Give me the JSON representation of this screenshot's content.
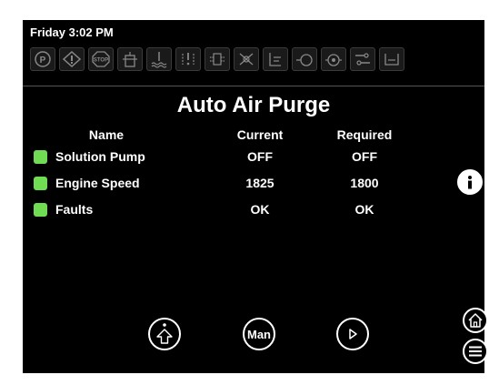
{
  "status": {
    "clock": "Friday 3:02 PM"
  },
  "indicators": [
    {
      "icon": "parking-brake-icon",
      "label": "(P)"
    },
    {
      "icon": "warning-icon",
      "label": "!"
    },
    {
      "icon": "stop-icon",
      "label": "STOP"
    },
    {
      "icon": "fluid-level-icon",
      "label": ""
    },
    {
      "icon": "coolant-temp-icon",
      "label": ""
    },
    {
      "icon": "air-filter-icon",
      "label": ""
    },
    {
      "icon": "fuel-filter-icon",
      "label": ""
    },
    {
      "icon": "heater-icon",
      "label": ""
    },
    {
      "icon": "oil-level-icon",
      "label": ""
    },
    {
      "icon": "pump-icon",
      "label": ""
    },
    {
      "icon": "engine-icon",
      "label": ""
    },
    {
      "icon": "hose-icon",
      "label": ""
    },
    {
      "icon": "tank-icon",
      "label": ""
    }
  ],
  "page": {
    "title": "Auto Air Purge"
  },
  "table": {
    "headers": {
      "name": "Name",
      "current": "Current",
      "required": "Required"
    },
    "rows": [
      {
        "name": "Solution Pump",
        "current": "OFF",
        "required": "OFF",
        "status_color": "#6fdc53"
      },
      {
        "name": "Engine Speed",
        "current": "1825",
        "required": "1800",
        "status_color": "#6fdc53"
      },
      {
        "name": "Faults",
        "current": "OK",
        "required": "OK",
        "status_color": "#6fdc53"
      }
    ]
  },
  "buttons": {
    "info": "info-icon",
    "man_label": "Man",
    "home": "home-icon",
    "menu": "menu-icon",
    "step_up": "up-arrow-icon",
    "play": "play-icon"
  },
  "colors": {
    "ok_led": "#6fdc53",
    "screen_bg": "#000000",
    "text": "#ffffff"
  }
}
